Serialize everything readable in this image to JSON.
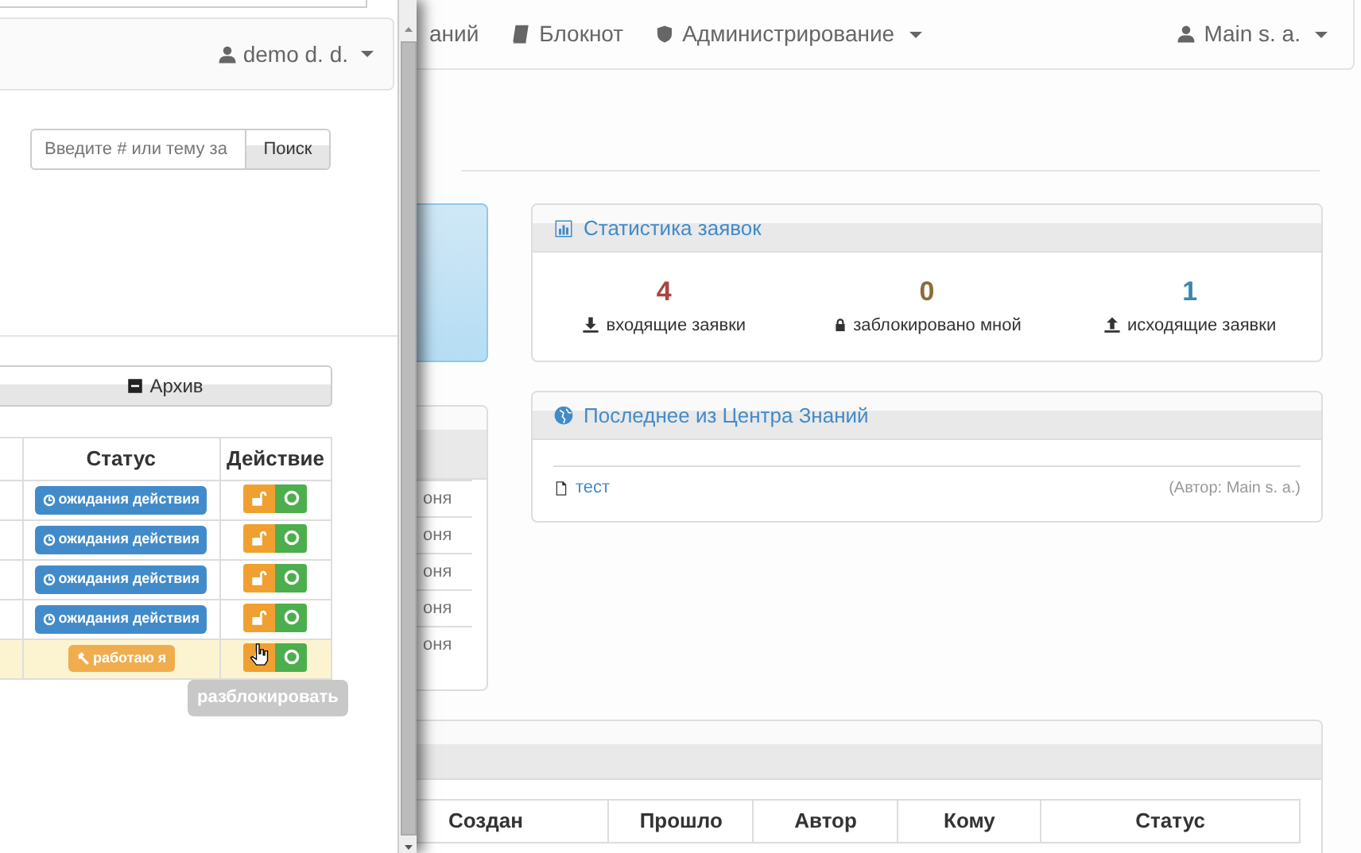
{
  "back_window": {
    "nav": [
      {
        "label": "аний",
        "dropdown": false
      },
      {
        "label": "Блокнот",
        "dropdown": false
      },
      {
        "label": "Администрирование",
        "dropdown": true
      }
    ],
    "user_menu": "Main s. a.",
    "stats": {
      "title": "Статистика заявок",
      "items": [
        {
          "value": "4",
          "label": "входящие заявки",
          "color": "#a94442"
        },
        {
          "value": "0",
          "label": "заблокировано мной",
          "color": "#8a6d3b"
        },
        {
          "value": "1",
          "label": "исходящие заявки",
          "color": "#3a87ad"
        }
      ]
    },
    "knowledge": {
      "title": "Последнее из Центра Знаний",
      "items": [
        {
          "title": "тест",
          "author": "(Автор: Main s. a.)"
        }
      ]
    },
    "side_rows": [
      "оня",
      "оня",
      "оня",
      "оня",
      "оня"
    ],
    "table_columns": [
      "Создан",
      "Прошло",
      "Автор",
      "Кому",
      "Статус"
    ]
  },
  "front_window": {
    "user_menu": "demo d. d.",
    "search": {
      "placeholder": "Введите # или тему за",
      "button": "Поиск"
    },
    "archive_button": "Архив",
    "table": {
      "columns": [
        "Статус",
        "Действие"
      ],
      "rows": [
        {
          "status": "ожидания действия",
          "kind": "waiting",
          "locked": false,
          "selected": false
        },
        {
          "status": "ожидания действия",
          "kind": "waiting",
          "locked": false,
          "selected": false
        },
        {
          "status": "ожидания действия",
          "kind": "waiting",
          "locked": false,
          "selected": false
        },
        {
          "status": "ожидания действия",
          "kind": "waiting",
          "locked": false,
          "selected": false
        },
        {
          "status": "работаю я",
          "kind": "mine",
          "locked": true,
          "selected": true
        }
      ]
    },
    "tooltip": "разблокировать"
  }
}
